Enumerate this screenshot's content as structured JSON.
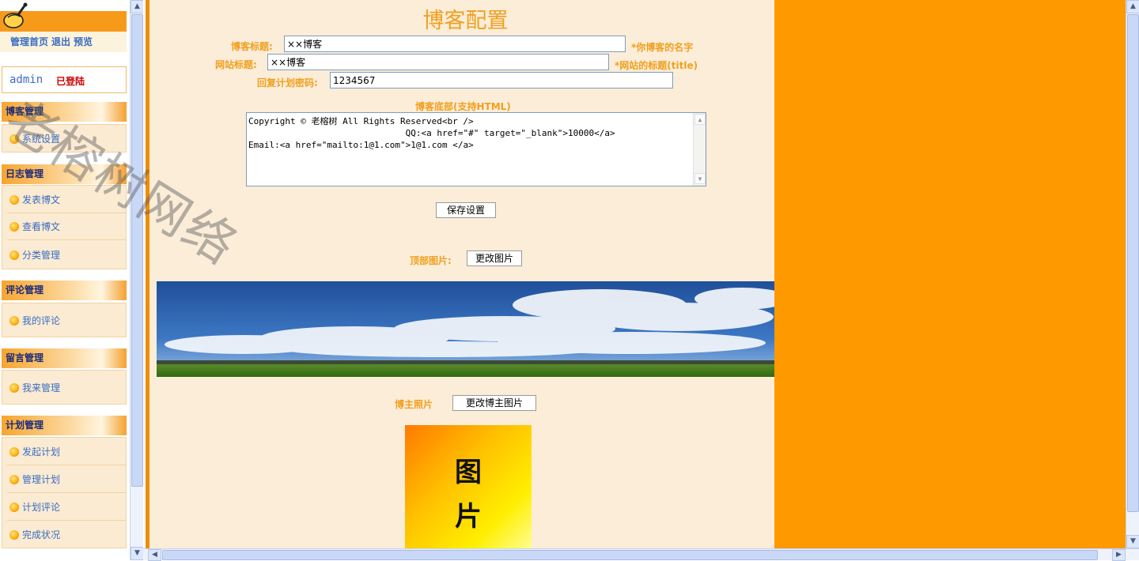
{
  "left": {
    "top_links": [
      "管理首页",
      "退出",
      "预览"
    ],
    "user": {
      "name": "admin",
      "status": "已登陆"
    },
    "sections": [
      {
        "title": "博客管理",
        "items": [
          "系统设置"
        ]
      },
      {
        "title": "日志管理",
        "items": [
          "发表博文",
          "查看博文",
          "分类管理"
        ]
      },
      {
        "title": "评论管理",
        "items": [
          "我的评论"
        ]
      },
      {
        "title": "留言管理",
        "items": [
          "我来管理"
        ]
      },
      {
        "title": "计划管理",
        "items": [
          "发起计划",
          "管理计划",
          "计划评论",
          "完成状况"
        ]
      }
    ]
  },
  "watermark": "老榕树网络",
  "main": {
    "title": "博客配置",
    "blog_title": {
      "label": "博客标题:",
      "value": "××博客",
      "note": "*你博客的名字"
    },
    "site_title": {
      "label": "网站标题:",
      "value": "××博客",
      "note": "*网站的标题(title)"
    },
    "reply_password": {
      "label": "回复计划密码:",
      "value": "1234567"
    },
    "footer": {
      "label": "博客底部(支持HTML)",
      "value": "Copyright © 老榕树 All Rights Reserved<br />\n                              QQ:<a href=\"#\" target=\"_blank\">10000</a>\nEmail:<a href=\"mailto:1@1.com\">1@1.com </a>"
    },
    "save_button": "保存设置",
    "top_image": {
      "label": "顶部图片:",
      "button": "更改图片"
    },
    "owner_photo": {
      "label": "博主照片",
      "button": "更改博主图片",
      "placeholder_text": "图\n片"
    }
  },
  "colors": {
    "accent": "#ff9900",
    "label": "#f0a020",
    "content_bg": "#fbedd8",
    "link": "#3a6cc0"
  }
}
